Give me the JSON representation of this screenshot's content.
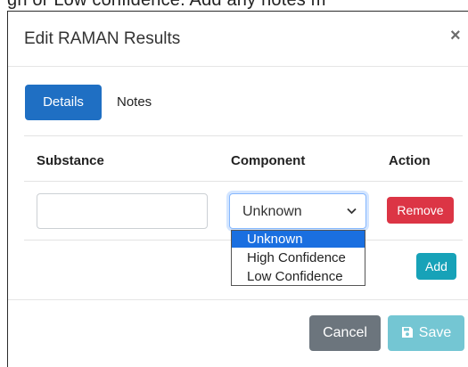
{
  "background_text": "gh or Low confidence. Add any notes m",
  "modal": {
    "title": "Edit RAMAN Results",
    "close_glyph": "×"
  },
  "tabs": [
    {
      "label": "Details",
      "active": true
    },
    {
      "label": "Notes",
      "active": false
    }
  ],
  "table": {
    "headers": [
      "Substance",
      "Component",
      "Action"
    ]
  },
  "row": {
    "substance_value": "",
    "component_selected": "Unknown",
    "remove_label": "Remove"
  },
  "dropdown": {
    "options": [
      "Unknown",
      "High Confidence",
      "Low Confidence"
    ],
    "highlighted": "Unknown"
  },
  "add_label": "Add",
  "footer": {
    "cancel_label": "Cancel",
    "save_label": "Save",
    "save_icon": "floppy-disk-icon"
  },
  "colors": {
    "primary": "#1f6fc3",
    "danger": "#dc3545",
    "info": "#17a2b8",
    "secondary": "#6c757d",
    "info_disabled": "#74c6d3",
    "dropdown_highlight": "#1a6fe0"
  }
}
